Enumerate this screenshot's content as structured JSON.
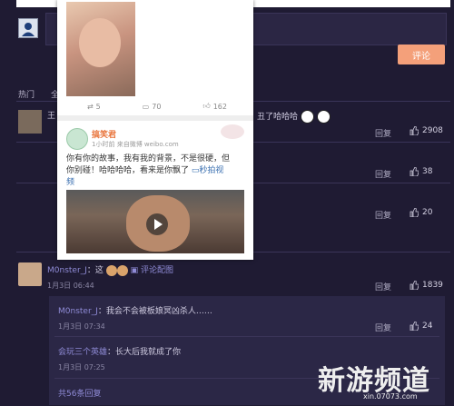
{
  "comment_box": {
    "submit_label": "评论"
  },
  "tabs": {
    "hot_label": "热门",
    "other_label": "全"
  },
  "popup": {
    "stats": {
      "reposts": "5",
      "comments": "70",
      "likes": "162"
    },
    "card": {
      "name": "搞笑君",
      "time": "1小时前",
      "source": "来自微博 weibo.com",
      "body_line1": "你有你的故事，我有我的背景，不是很硬，但",
      "body_line2": "你别碰！哈哈哈哈，看来是你飘了",
      "link_text": "秒拍视",
      "link_text2": "频"
    }
  },
  "comments": [
    {
      "user_prefix": "王",
      "tail_text": "丑了哈哈哈",
      "reply": "回复",
      "likes": "2908"
    },
    {
      "reply": "回复",
      "likes": "38"
    },
    {
      "reply": "回复",
      "likes": "20"
    },
    {
      "user": "M0nster_J",
      "text": "：这",
      "action": "评论配图",
      "date": "1月3日 06:44",
      "reply": "回复",
      "likes": "1839",
      "sub_replies": [
        {
          "user": "M0nster_J",
          "text": "：我会不会被板娘冥凶杀人……",
          "date": "1月3日 07:34",
          "reply": "回复",
          "likes": "24"
        },
        {
          "user": "会玩三个英雄",
          "text": "：长大后我就成了你",
          "date": "1月3日 07:25"
        }
      ],
      "more": "共56条回复"
    }
  ],
  "watermark": {
    "main": "新游频道",
    "sub": "xin.07073.com"
  }
}
